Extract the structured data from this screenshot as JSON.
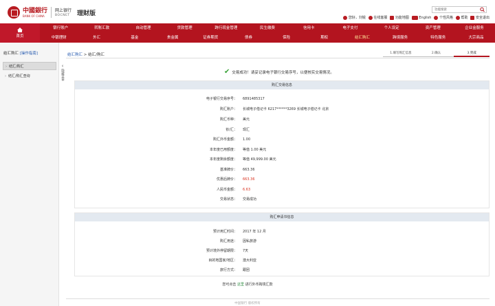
{
  "header": {
    "bank_name_cn": "中國銀行",
    "bank_name_en": "BANK OF CHINA",
    "netbank_label": "网上银行",
    "netbank_en": "BOCNET",
    "product": "理财版",
    "search_placeholder": "功能搜索",
    "greeting": "您好，刘锐",
    "links": [
      "在线客服",
      "功能地图",
      "English",
      "个性风格",
      "帮助",
      "安全退出"
    ]
  },
  "nav": {
    "home": "首页",
    "row1": [
      "银行账户",
      "转账汇款",
      "自动管理",
      "贷款管理",
      "跨行现金管理",
      "民生缴费",
      "信用卡",
      "电子支付",
      "个人设定",
      "资产管理",
      "企业金服务"
    ],
    "row2": [
      "中银理财",
      "外汇",
      "基金",
      "贵金属",
      "证券期货",
      "债券",
      "保险",
      "期权",
      "结汇购汇",
      "跨境服务",
      "特色服务",
      "大宗商品"
    ],
    "active_item": "结汇购汇"
  },
  "sidebar": {
    "title": "结汇购汇",
    "title_link": "[操作指南]",
    "items": [
      "结汇/购汇",
      "结汇/购汇查询"
    ],
    "collapse_label": "隐藏菜单"
  },
  "breadcrumb": {
    "link": "结汇购汇",
    "sep": ">",
    "current": "结汇/购汇"
  },
  "steps": [
    "1.填写购汇信息",
    "2.确认",
    "3.完成"
  ],
  "success_message": "交易成功！请妥记录电子银行交易序号，以便核实交易情况。",
  "section1": {
    "title": "购汇交易信息",
    "rows": [
      {
        "label": "电子银行交易序号：",
        "value": "6891485317"
      },
      {
        "label": "购汇账户：",
        "value": "长城电子借记卡  6217******3269  长城电子借记卡  北京"
      },
      {
        "label": "购汇币种：",
        "value": "美元"
      },
      {
        "label": "钞/汇：",
        "value": "现汇"
      },
      {
        "label": "购汇外币金额：",
        "value": "1.00"
      },
      {
        "label": "本年度已用额度：",
        "value": "等值  1.00 美元"
      },
      {
        "label": "本年度剩余额度：",
        "value": "等值  49,999.00 美元"
      },
      {
        "label": "基准牌价：",
        "value": "663.36"
      },
      {
        "label": "优惠后牌价：",
        "value": "663.36"
      },
      {
        "label": "人民币金额：",
        "value": "6.63"
      },
      {
        "label": "交易状态：",
        "value": "交易成功"
      }
    ]
  },
  "section2": {
    "title": "购汇申请书信息",
    "rows": [
      {
        "label": "预计用汇时间：",
        "value": "2017 年  12 月"
      },
      {
        "label": "购汇用途：",
        "value": "因私旅游"
      },
      {
        "label": "预计境外停留期限：",
        "value": "7天"
      },
      {
        "label": "目的地国家/地区：",
        "value": "澳大利亚"
      },
      {
        "label": "旅行方式：",
        "value": "跟团"
      }
    ]
  },
  "footer_tip": {
    "prefix": "您可点击",
    "link": "这里",
    "suffix": "进行外币跨境汇款"
  },
  "copyright": "中国银行 版权所有"
}
